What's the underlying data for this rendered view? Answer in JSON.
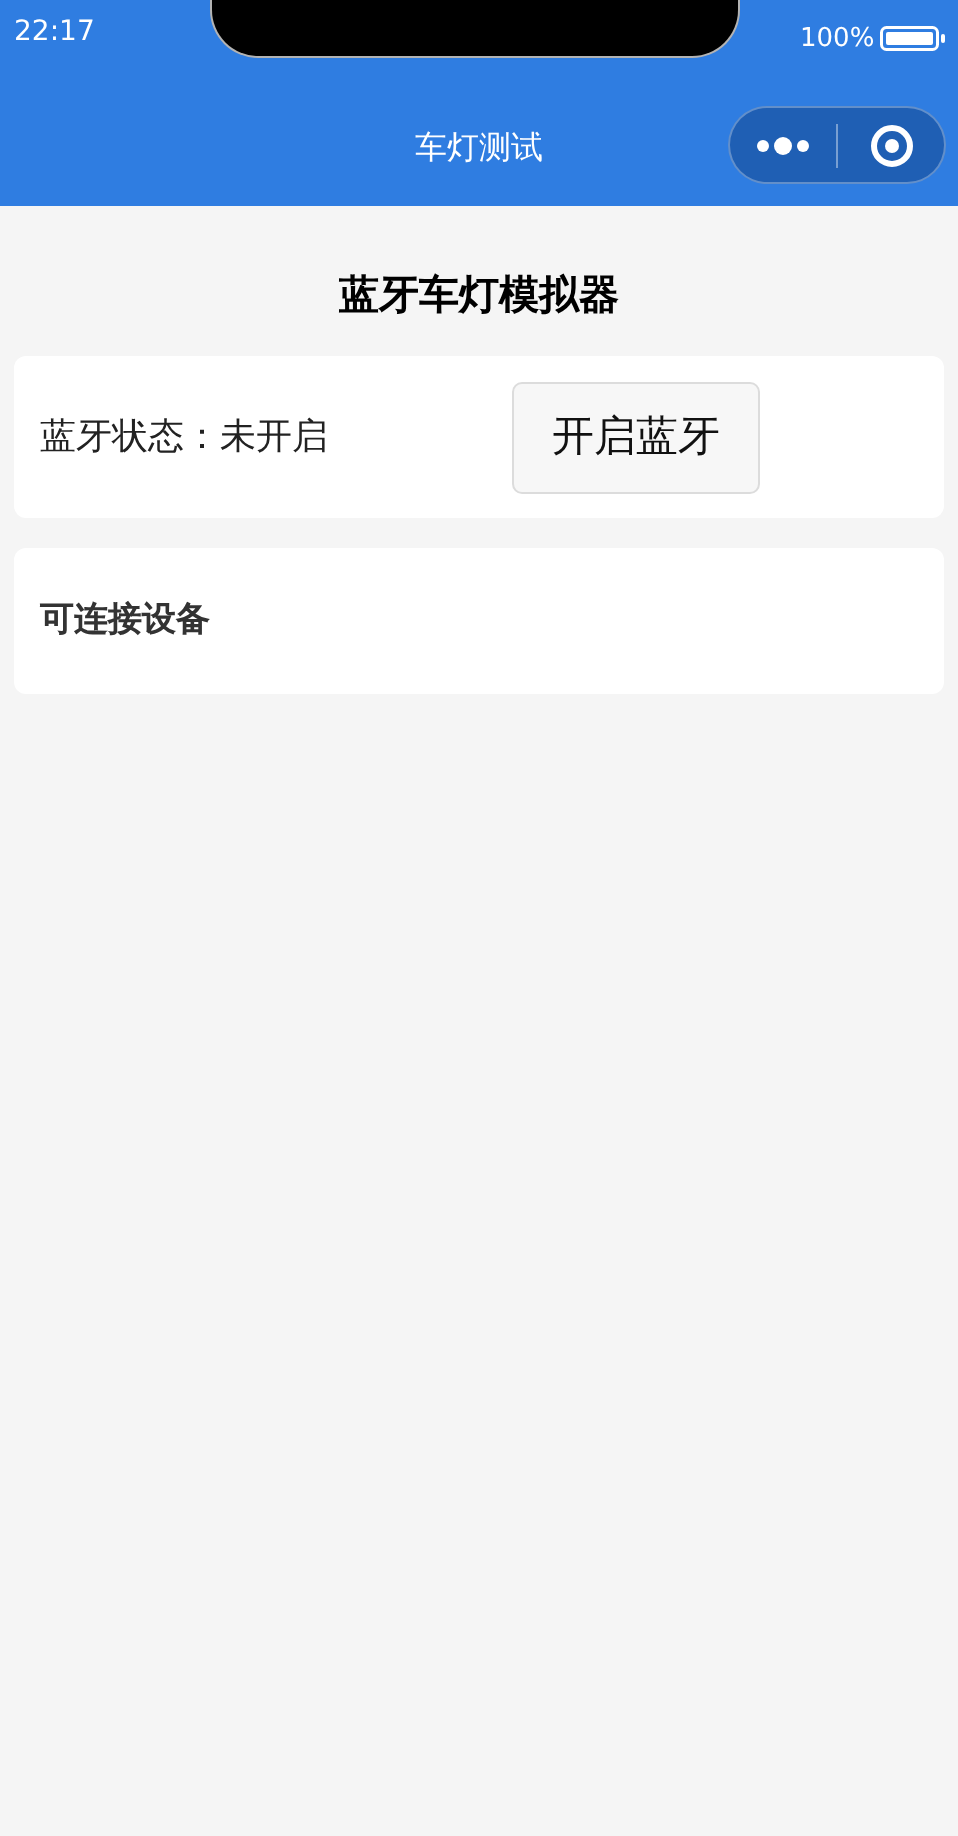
{
  "status_bar": {
    "time": "22:17",
    "battery": "100%"
  },
  "nav_bar": {
    "title": "车灯测试"
  },
  "heading": "蓝牙车灯模拟器",
  "bluetooth_card": {
    "status": "蓝牙状态：未开启",
    "button": "开启蓝牙"
  },
  "devices_card": {
    "title": "可连接设备"
  }
}
